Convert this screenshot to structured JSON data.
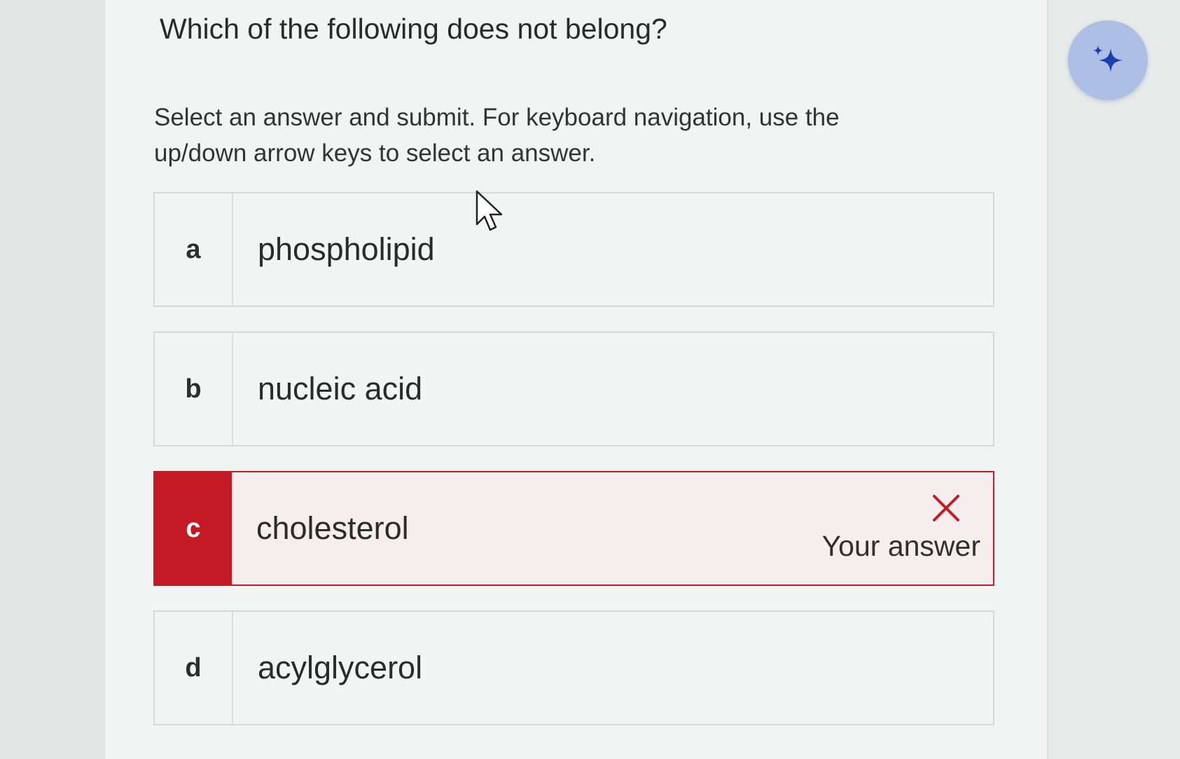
{
  "question": {
    "prompt": "Which of the following does not belong?",
    "instructions": "Select an answer and submit. For keyboard navigation, use the up/down arrow keys to select an answer."
  },
  "assist": {
    "icon": "sparkle-icon"
  },
  "options": [
    {
      "letter": "a",
      "text": "phospholipid",
      "state": "unselected"
    },
    {
      "letter": "b",
      "text": "nucleic acid",
      "state": "unselected"
    },
    {
      "letter": "c",
      "text": "cholesterol",
      "state": "incorrect"
    },
    {
      "letter": "d",
      "text": "acylglycerol",
      "state": "unselected"
    }
  ],
  "feedback": {
    "label": "Your answer",
    "icon": "x-mark-icon",
    "color": "#c41a26"
  },
  "colors": {
    "incorrect": "#c41a26",
    "assist_bg": "#aebfe6",
    "assist_icon": "#1a3fae"
  }
}
